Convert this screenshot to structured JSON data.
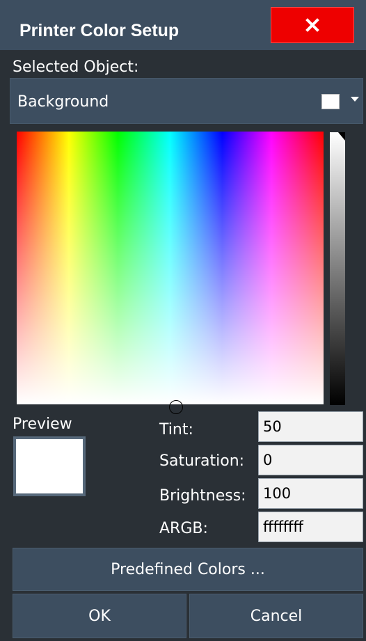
{
  "dialog": {
    "title": "Printer Color Setup",
    "close_icon": "close-icon",
    "close_color": "#ee0000"
  },
  "selected_object": {
    "label": "Selected Object:",
    "value": "Background",
    "swatch_color": "#ffffff",
    "dropdown_icon": "caret-down-icon"
  },
  "color_picker": {
    "hue_marker_position_fraction": 0.5,
    "brightness_level_fraction": 1.0
  },
  "preview": {
    "label": "Preview",
    "color": "#ffffff"
  },
  "fields": {
    "tint": {
      "label": "Tint:",
      "value": "50"
    },
    "saturation": {
      "label": "Saturation:",
      "value": "0"
    },
    "brightness": {
      "label": "Brightness:",
      "value": "100"
    },
    "argb": {
      "label": "ARGB:",
      "value": "ffffffff"
    }
  },
  "buttons": {
    "predefined": "Predefined Colors ...",
    "ok": "OK",
    "cancel": "Cancel"
  },
  "colors": {
    "panel_bg": "#2a3036",
    "control_bg": "#3d4e60",
    "accent_close": "#ee0000"
  }
}
